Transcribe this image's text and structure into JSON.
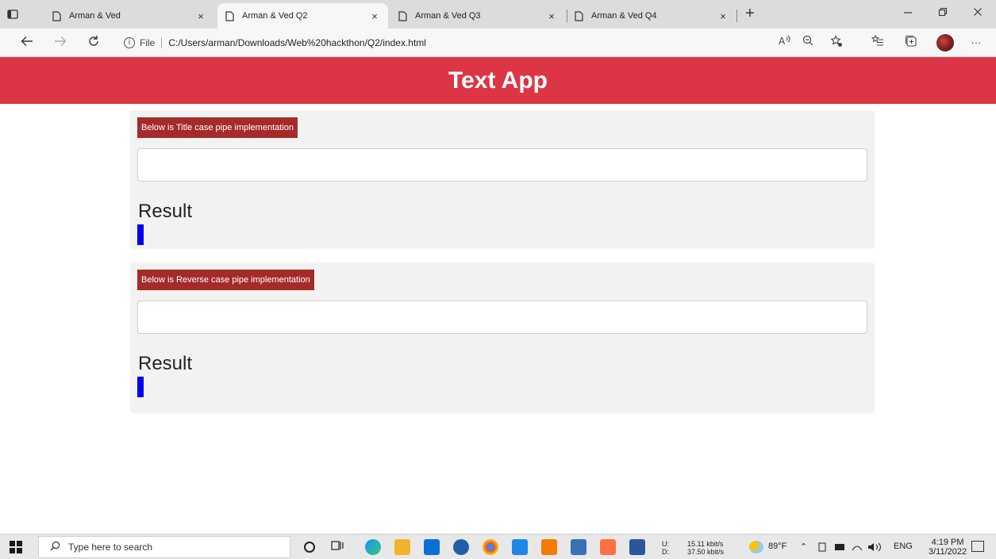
{
  "browser": {
    "tabs": [
      {
        "label": "Arman & Ved",
        "active": false
      },
      {
        "label": "Arman & Ved Q2",
        "active": true
      },
      {
        "label": "Arman & Ved Q3",
        "active": false
      },
      {
        "label": "Arman & Ved Q4",
        "active": false
      }
    ],
    "close_glyph": "×",
    "new_tab_glyph": "+",
    "address": {
      "scheme_label": "File",
      "url": "C:/Users/arman/Downloads/Web%20hackthon/Q2/index.html"
    }
  },
  "app": {
    "title": "Text App",
    "cards": [
      {
        "badge": "Below is Title case pipe implementation",
        "input_value": "",
        "result_heading": "Result"
      },
      {
        "badge": "Below is Reverse case pipe implementation",
        "input_value": "",
        "result_heading": "Result"
      }
    ],
    "colors": {
      "header": "#dc3545",
      "badge": "#a52a2a",
      "result_bar": "#0000ee",
      "card": "#f2f2f2"
    }
  },
  "taskbar": {
    "search_placeholder": "Type here to search",
    "net_up_label": "U:",
    "net_down_label": "D:",
    "net_up": "15.11 kbit/s",
    "net_down": "37.50 kbit/s",
    "weather": "89°F",
    "language": "ENG",
    "time": "4:19 PM",
    "date": "3/11/2022"
  }
}
